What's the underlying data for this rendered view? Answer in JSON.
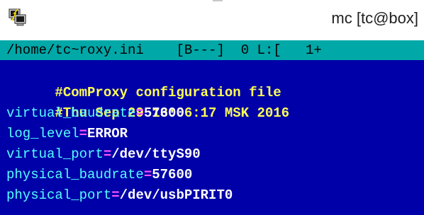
{
  "window": {
    "title": "mc [tc@box]",
    "icon": "putty-terminal-icon"
  },
  "editor": {
    "status": {
      "file": "/home/tc~roxy.ini",
      "flags": "[B---]",
      "col": "0",
      "line_label": "L:[",
      "line_value": "1+"
    },
    "lines": [
      {
        "type": "comment",
        "text": "#ComProxy configuration file"
      },
      {
        "type": "comment",
        "text": "#Thu Sep 29 13:06:17 MSK 2016"
      },
      {
        "type": "kv",
        "key": "virtual_baudrate",
        "eq": "=",
        "value": "57600"
      },
      {
        "type": "kv",
        "key": "log_level",
        "eq": "=",
        "value": "ERROR"
      },
      {
        "type": "kv",
        "key": "virtual_port",
        "eq": "=",
        "value": "/dev/ttyS90"
      },
      {
        "type": "kv",
        "key": "physical_baudrate",
        "eq": "=",
        "value": "57600"
      },
      {
        "type": "kv",
        "key": "physical_port",
        "eq": "=",
        "value": "/dev/usbPIRIT0"
      }
    ]
  },
  "colors": {
    "editor_background": "#0000a8",
    "status_background": "#00a8a8",
    "comment": "#ffff55",
    "key": "#55ffff",
    "equals": "#ff55ff",
    "value": "#ffffff"
  }
}
